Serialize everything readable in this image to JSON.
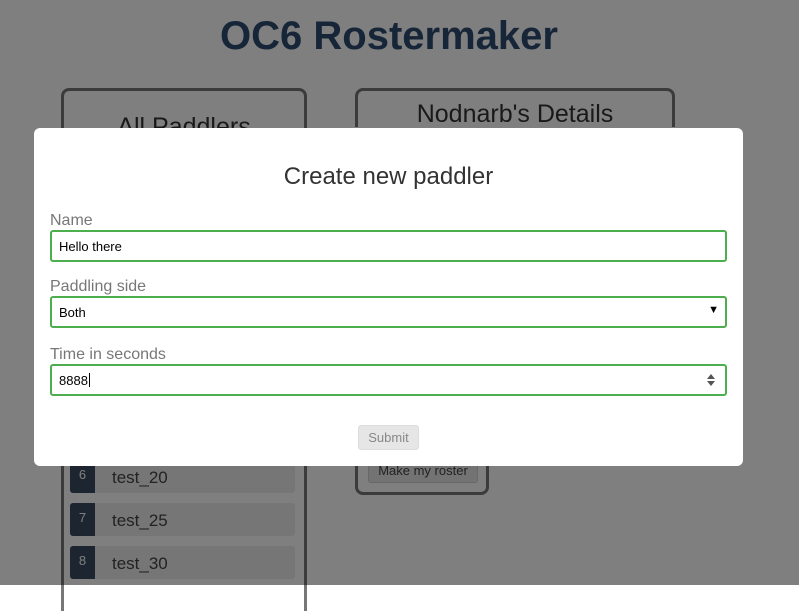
{
  "app": {
    "title": "OC6 Rostermaker"
  },
  "all_paddlers": {
    "heading": "All Paddlers",
    "visible_items": [
      {
        "number": "6",
        "name": "test_20"
      },
      {
        "number": "7",
        "name": "test_25"
      },
      {
        "number": "8",
        "name": "test_30"
      }
    ]
  },
  "details": {
    "heading": "Nodnarb's Details",
    "make_roster_label": "Make my roster"
  },
  "modal": {
    "title": "Create new paddler",
    "name": {
      "label": "Name",
      "value": "Hello there"
    },
    "side": {
      "label": "Paddling side",
      "value": "Both"
    },
    "time": {
      "label": "Time in seconds",
      "value": "8888"
    },
    "submit_label": "Submit"
  },
  "colors": {
    "title": "#2c4a6e",
    "field_border_valid": "#4cae4c",
    "number_badge": "#3b4d60",
    "overlay": "rgba(0,0,0,0.5)"
  },
  "icons": {
    "select_arrow": "chevron-down-icon",
    "spinner": "spinner-arrows-icon"
  }
}
